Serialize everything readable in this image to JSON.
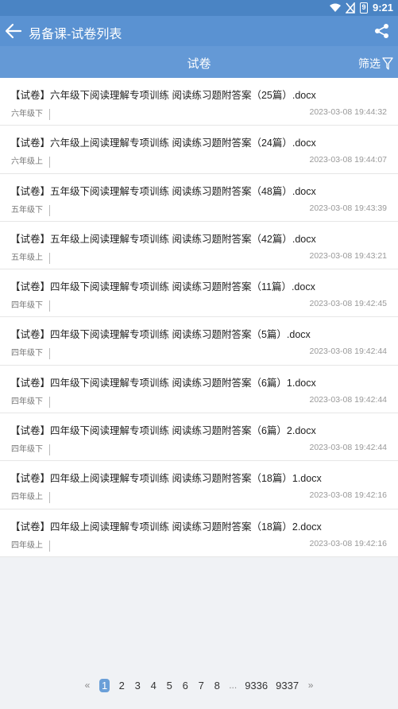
{
  "status": {
    "time": "9:21",
    "battery": "9",
    "wifi_icon": "wifi-icon",
    "signal_icon": "signal-off-icon",
    "battery_icon": "battery-icon"
  },
  "app_bar": {
    "title": "易备课-试卷列表",
    "back_icon": "arrow-left-icon",
    "share_icon": "share-icon"
  },
  "tab_bar": {
    "title": "试卷",
    "filter_label": "筛选",
    "filter_icon": "filter-icon"
  },
  "items": [
    {
      "title": "【试卷】六年级下阅读理解专项训练 阅读练习题附答案（25篇）.docx",
      "grade": "六年级下",
      "time": "2023-03-08 19:44:32"
    },
    {
      "title": "【试卷】六年级上阅读理解专项训练 阅读练习题附答案（24篇）.docx",
      "grade": "六年级上",
      "time": "2023-03-08 19:44:07"
    },
    {
      "title": "【试卷】五年级下阅读理解专项训练 阅读练习题附答案（48篇）.docx",
      "grade": "五年级下",
      "time": "2023-03-08 19:43:39"
    },
    {
      "title": "【试卷】五年级上阅读理解专项训练 阅读练习题附答案（42篇）.docx",
      "grade": "五年级上",
      "time": "2023-03-08 19:43:21"
    },
    {
      "title": "【试卷】四年级下阅读理解专项训练 阅读练习题附答案（11篇）.docx",
      "grade": "四年级下",
      "time": "2023-03-08 19:42:45"
    },
    {
      "title": "【试卷】四年级下阅读理解专项训练 阅读练习题附答案（5篇）.docx",
      "grade": "四年级下",
      "time": "2023-03-08 19:42:44"
    },
    {
      "title": "【试卷】四年级下阅读理解专项训练 阅读练习题附答案（6篇）1.docx",
      "grade": "四年级下",
      "time": "2023-03-08 19:42:44"
    },
    {
      "title": "【试卷】四年级下阅读理解专项训练 阅读练习题附答案（6篇）2.docx",
      "grade": "四年级下",
      "time": "2023-03-08 19:42:44"
    },
    {
      "title": "【试卷】四年级上阅读理解专项训练 阅读练习题附答案（18篇）1.docx",
      "grade": "四年级上",
      "time": "2023-03-08 19:42:16"
    },
    {
      "title": "【试卷】四年级上阅读理解专项训练 阅读练习题附答案（18篇）2.docx",
      "grade": "四年级上",
      "time": "2023-03-08 19:42:16"
    }
  ],
  "pagination": {
    "prev": "«",
    "pages": [
      "1",
      "2",
      "3",
      "4",
      "5",
      "6",
      "7",
      "8"
    ],
    "dots": "...",
    "tail": [
      "9336",
      "9337"
    ],
    "next": "»",
    "current": "1"
  }
}
